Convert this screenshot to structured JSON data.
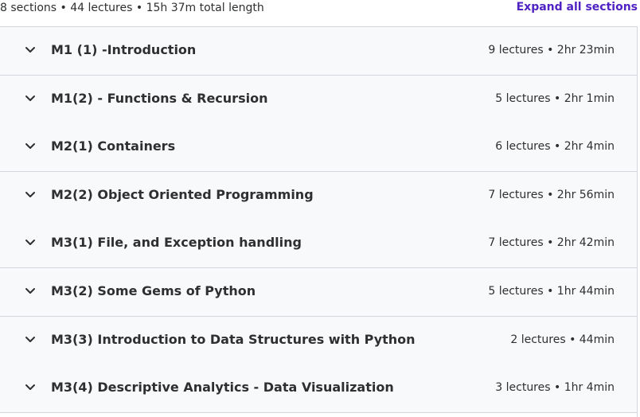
{
  "summary": {
    "text": "8 sections • 44 lectures • 15h 37m total length",
    "expand_all_label": "Expand all sections"
  },
  "sections": [
    {
      "title": "M1 (1) -Introduction",
      "meta": "9 lectures • 2hr 23min"
    },
    {
      "title": "M1(2) - Functions & Recursion",
      "meta": "5 lectures • 2hr 1min"
    },
    {
      "title": "M2(1) Containers",
      "meta": "6 lectures • 2hr 4min"
    },
    {
      "title": "M2(2) Object Oriented Programming",
      "meta": "7 lectures • 2hr 56min"
    },
    {
      "title": "M3(1) File, and Exception handling",
      "meta": "7 lectures • 2hr 42min"
    },
    {
      "title": "M3(2) Some Gems of Python",
      "meta": "5 lectures • 1hr 44min"
    },
    {
      "title": "M3(3) Introduction to Data Structures with Python",
      "meta": "2 lectures • 44min"
    },
    {
      "title": "M3(4) Descriptive Analytics - Data Visualization",
      "meta": "3 lectures • 1hr 4min"
    }
  ],
  "icons": {
    "section_toggle": "chevron-down-icon"
  },
  "colors": {
    "accent": "#5022c3",
    "row_background": "#f7f9fa",
    "border": "#d1d7dc",
    "text": "#2d2f31"
  }
}
